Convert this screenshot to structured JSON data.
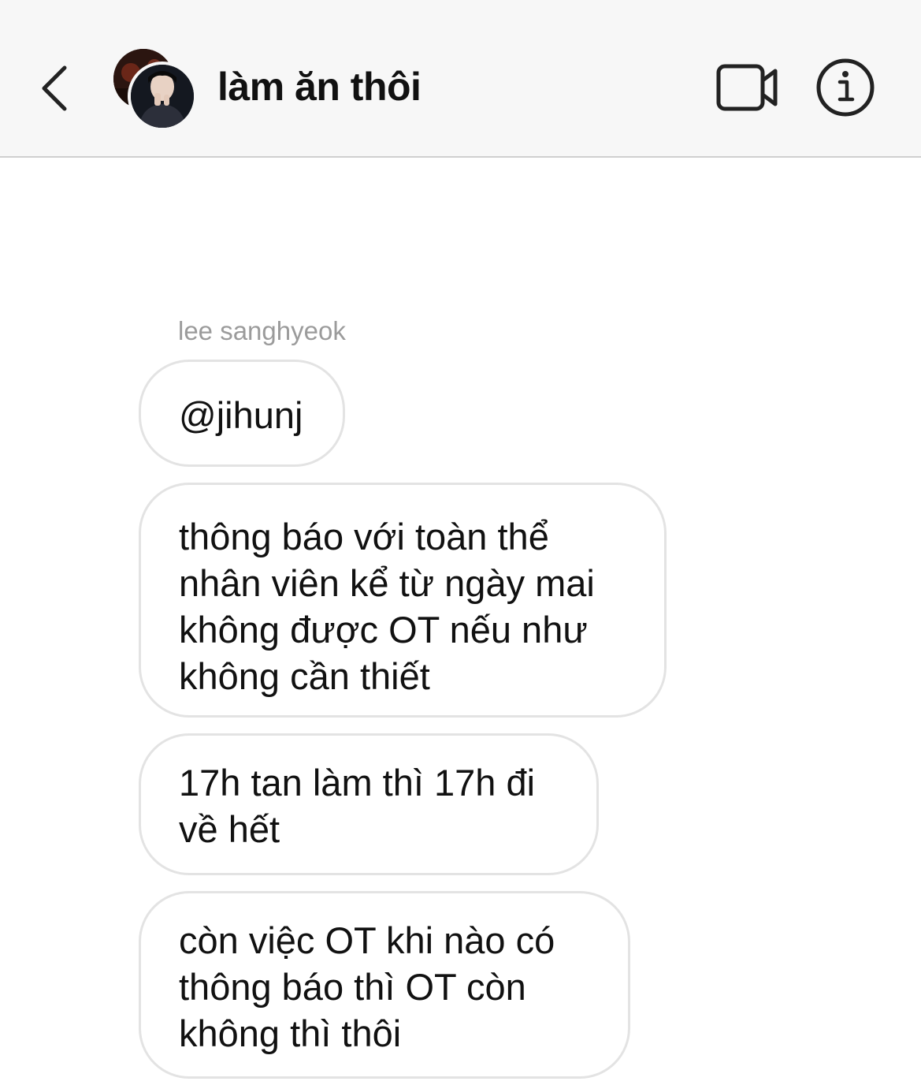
{
  "header": {
    "title": "làm ăn thôi",
    "icons": {
      "back": "chevron-left-icon",
      "video": "video-camera-icon",
      "info": "info-circle-icon"
    }
  },
  "messages": {
    "sender": "lee sanghyeok",
    "items": [
      {
        "text": "@jihunj"
      },
      {
        "text": "thông báo với toàn thể\nnhân viên kể từ ngày mai\nkhông được OT nếu như\nkhông cần thiết"
      },
      {
        "text": "17h tan làm thì 17h đi\nvề hết"
      },
      {
        "text": "còn việc OT khi nào có\nthông báo thì OT còn\nkhông thì thôi"
      }
    ]
  },
  "colors": {
    "header_bg": "#f7f7f7",
    "bubble_border": "#e3e3e3",
    "sender_name": "#9b9b9b",
    "text": "#111111"
  }
}
